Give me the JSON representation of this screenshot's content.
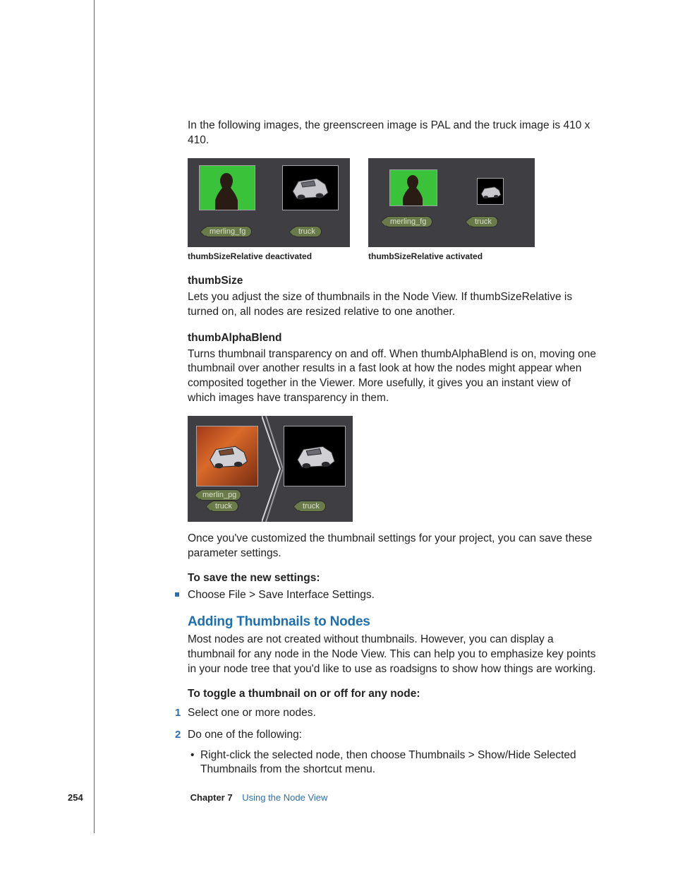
{
  "intro_para": "In the following images, the greenscreen image is PAL and the truck image is 410 x 410.",
  "figA": {
    "node1_label": "merling_fg",
    "node2_label": "truck",
    "caption": "thumbSizeRelative deactivated"
  },
  "figB": {
    "node1_label": "merling_fg",
    "node2_label": "truck",
    "caption": "thumbSizeRelative activated"
  },
  "thumbSize": {
    "title": "thumbSize",
    "body": "Lets you adjust the size of thumbnails in the Node View. If thumbSizeRelative is turned on, all nodes are resized relative to one another."
  },
  "thumbAlphaBlend": {
    "title": "thumbAlphaBlend",
    "body": "Turns thumbnail transparency on and off. When thumbAlphaBlend is on, moving one thumbnail over another results in a fast look at how the nodes might appear when composited together in the Viewer. More usefully, it gives you an instant view of which images have transparency in them."
  },
  "figC": {
    "node_left_back": "merlin_pg",
    "node_left_front": "truck",
    "node_right": "truck"
  },
  "after_fig3": "Once you've customized the thumbnail settings for your project, you can save these parameter settings.",
  "save_heading": "To save the new settings:",
  "save_bullet": "Choose File > Save Interface Settings.",
  "section_heading": "Adding Thumbnails to Nodes",
  "section_body": "Most nodes are not created without thumbnails. However, you can display a thumbnail for any node in the Node View. This can help you to emphasize key points in your node tree that you'd like to use as roadsigns to show how things are working.",
  "toggle_heading": "To toggle a thumbnail on or off for any node:",
  "steps": {
    "1": "Select one or more nodes.",
    "2": "Do one of the following:",
    "2a": "Right-click the selected node, then choose Thumbnails > Show/Hide Selected Thumbnails from the shortcut menu."
  },
  "footer": {
    "page": "254",
    "chapter_label": "Chapter 7",
    "chapter_title": "Using the Node View"
  }
}
